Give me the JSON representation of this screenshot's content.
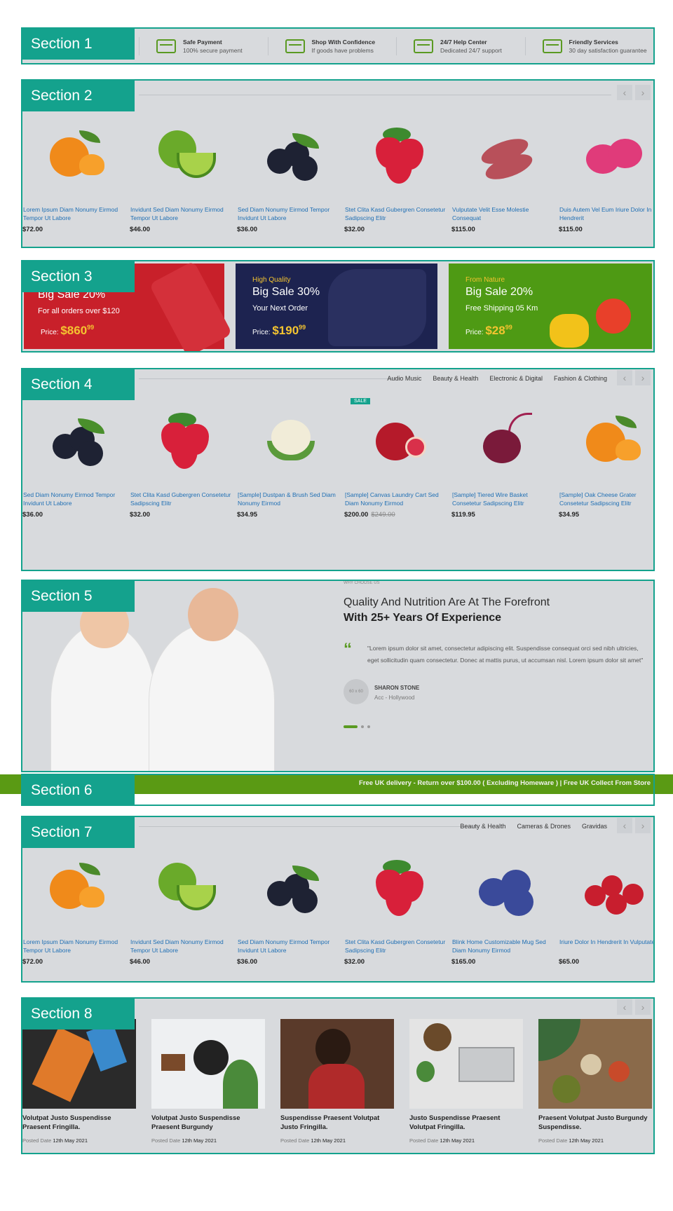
{
  "sections": [
    "Section 1",
    "Section 2",
    "Section 3",
    "Section 4",
    "Section 5",
    "Section 6",
    "Section 7",
    "Section 8"
  ],
  "services": [
    {
      "icon": "credit-card-icon",
      "title": "Safe Payment",
      "sub": "100% secure payment"
    },
    {
      "icon": "hand-shield-icon",
      "title": "Shop With Confidence",
      "sub": "If goods have problems"
    },
    {
      "icon": "chat-bubble-icon",
      "title": "24/7 Help Center",
      "sub": "Dedicated 24/7 support"
    },
    {
      "icon": "list-card-icon",
      "title": "Friendly Services",
      "sub": "30 day satisfaction guarantee"
    }
  ],
  "arrows": {
    "prev": "‹",
    "next": "›"
  },
  "products_s2": [
    {
      "icon": "orange-icon",
      "name": "Lorem Ipsum Diam Nonumy Eirmod Tempor Ut Labore",
      "price": "$72.00"
    },
    {
      "icon": "lime-icon",
      "name": "Invidunt Sed Diam Nonumy Eirmod Tempor Ut Labore",
      "price": "$46.00"
    },
    {
      "icon": "blueberry-icon",
      "name": "Sed Diam Nonumy Eirmod Tempor Invidunt Ut Labore",
      "price": "$36.00"
    },
    {
      "icon": "strawberry-icon",
      "name": "Stet Clita Kasd Gubergren Consetetur Sadipscing Elitr",
      "price": "$32.00"
    },
    {
      "icon": "sweet-potato-icon",
      "name": "Vulputate Velit Esse Molestie Consequat",
      "price": "$115.00"
    },
    {
      "icon": "dragon-fruit-icon",
      "name": "Duis Autem Vel Eum Iriure Dolor In Hendrerit",
      "price": "$115.00"
    }
  ],
  "banners": [
    {
      "tag": "",
      "title": "Big Sale 20%",
      "sub": "For all orders over $120",
      "price_label": "Price:",
      "price": "$860",
      "cents": "99",
      "bg": "#c8202a"
    },
    {
      "tag": "High Quality",
      "title": "Big Sale 30%",
      "sub": "Your Next Order",
      "price_label": "Price:",
      "price": "$190",
      "cents": "99",
      "bg": "#1d2350"
    },
    {
      "tag": "From Nature",
      "title": "Big Sale 20%",
      "sub": "Free Shipping 05 Km",
      "price_label": "Price:",
      "price": "$28",
      "cents": "99",
      "bg": "#4e9a14"
    }
  ],
  "tabs_s4": [
    "Audio Music",
    "Beauty & Health",
    "Electronic & Digital",
    "Fashion & Clothing"
  ],
  "products_s4": [
    {
      "icon": "blueberry-icon",
      "name": "Sed Diam Nonumy Eirmod Tempor Invidunt Ut Labore",
      "price": "$36.00",
      "old": "",
      "sale": ""
    },
    {
      "icon": "strawberry-icon",
      "name": "Stet Clita Kasd Gubergren Consetetur Sadipscing Elitr",
      "price": "$32.00",
      "old": "",
      "sale": ""
    },
    {
      "icon": "cauliflower-icon",
      "name": "[Sample] Dustpan & Brush Sed Diam Nonumy Eirmod",
      "price": "$34.95",
      "old": "",
      "sale": ""
    },
    {
      "icon": "pomegranate-icon",
      "name": "[Sample] Canvas Laundry Cart Sed Diam Nonumy Eirmod",
      "price": "$200.00",
      "old": "$249.00",
      "sale": "SALE"
    },
    {
      "icon": "beetroot-icon",
      "name": "[Sample] Tiered Wire Basket Consetetur Sadipscing Elitr",
      "price": "$119.95",
      "old": "",
      "sale": ""
    },
    {
      "icon": "orange-icon",
      "name": "[Sample] Oak Cheese Grater Consetetur Sadipscing Elitr",
      "price": "$34.95",
      "old": "",
      "sale": ""
    }
  ],
  "about": {
    "kicker": "WHY CHOOSE US",
    "line1": "Quality And Nutrition Are At The Forefront",
    "line2": "With 25+ Years Of Experience",
    "quote_mark": "“",
    "quote": "\"Lorem ipsum dolor sit amet, consectetur adipiscing elit. Suspendisse consequat orci sed nibh ultricies, eget sollicitudin quam consectetur. Donec at mattis purus, ut accumsan nisl. Lorem ipsum dolor sit amet\"",
    "avatar": "60 x 60",
    "author": "SHARON STONE",
    "role": "Acc - Hollywood"
  },
  "marquee": "Free UK delivery - Return over $100.00 ( Excluding Homeware ) | Free UK Collect From Store",
  "tabs_s7": [
    "Beauty & Health",
    "Cameras & Drones",
    "Gravidas"
  ],
  "products_s7": [
    {
      "icon": "orange-icon",
      "name": "Lorem Ipsum Diam Nonumy Eirmod Tempor Ut Labore",
      "price": "$72.00"
    },
    {
      "icon": "lime-icon",
      "name": "Invidunt Sed Diam Nonumy Eirmod Tempor Ut Labore",
      "price": "$46.00"
    },
    {
      "icon": "blueberry-icon",
      "name": "Sed Diam Nonumy Eirmod Tempor Invidunt Ut Labore",
      "price": "$36.00"
    },
    {
      "icon": "strawberry-icon",
      "name": "Stet Clita Kasd Gubergren Consetetur Sadipscing Elitr",
      "price": "$32.00"
    },
    {
      "icon": "plum-icon",
      "name": "Blink Home Customizable Mug Sed Diam Nonumy Eirmod",
      "price": "$165.00"
    },
    {
      "icon": "cherry-icon",
      "name": "Iriure Dolor In Hendrerit In Vulputate",
      "price": "$65.00"
    }
  ],
  "blogs": [
    {
      "title": "Volutpat Justo Suspendisse Praesent Fringilla.",
      "date_label": "Posted Date",
      "date": "12th May 2021"
    },
    {
      "title": "Volutpat Justo Suspendisse Praesent Burgundy",
      "date_label": "Posted Date",
      "date": "12th May 2021"
    },
    {
      "title": "Suspendisse Praesent Volutpat Justo Fringilla.",
      "date_label": "Posted Date",
      "date": "12th May 2021"
    },
    {
      "title": "Justo Suspendisse Praesent Volutpat Fringilla.",
      "date_label": "Posted Date",
      "date": "12th May 2021"
    },
    {
      "title": "Praesent Volutpat Justo Burgundy Suspendisse.",
      "date_label": "Posted Date",
      "date": "12th May 2021"
    }
  ],
  "colors": {
    "accent": "#14a28d",
    "green": "#5a9a14",
    "link": "#1f6fb4",
    "gold": "#f4c430"
  }
}
